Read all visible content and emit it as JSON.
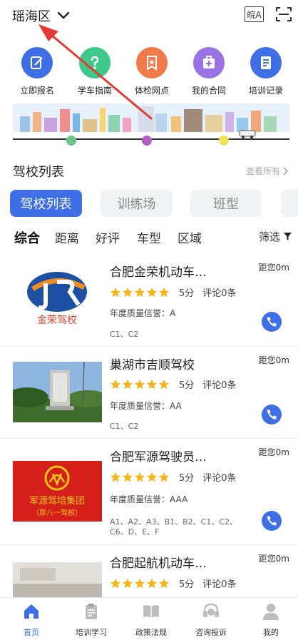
{
  "header": {
    "city": "瑶海区",
    "font_toggle": "皖A"
  },
  "quick_actions": [
    {
      "label": "立即报名",
      "icon": "edit-icon",
      "color": "#3f6fe7"
    },
    {
      "label": "学车指南",
      "icon": "question-icon",
      "color": "#3ec88a"
    },
    {
      "label": "体检网点",
      "icon": "bookmark-star-icon",
      "color": "#f07a4a"
    },
    {
      "label": "我的合同",
      "icon": "medical-kit-icon",
      "color": "#9a72e6"
    },
    {
      "label": "培训记录",
      "icon": "document-icon",
      "color": "#3f6fe7"
    }
  ],
  "section": {
    "title": "驾校列表",
    "view_all": "查看所有"
  },
  "tabs": [
    "驾校列表",
    "训练场",
    "班型",
    "教"
  ],
  "filters": {
    "items": [
      "综合",
      "距离",
      "好评",
      "车型",
      "区域"
    ],
    "filter_label": "筛选"
  },
  "schools": [
    {
      "name": "合肥金荣机动车…",
      "distance": "距您0m",
      "rating": 5,
      "score": "5分",
      "reviews": "评论0条",
      "quality": "年度质量信誉：A",
      "types": "C1、C2",
      "logo_text": "金荣驾校"
    },
    {
      "name": "巢湖市吉顺驾校",
      "distance": "距您0m",
      "rating": 5,
      "score": "5分",
      "reviews": "评论0条",
      "quality": "年度质量信誉：AA",
      "types": "C1、C2"
    },
    {
      "name": "合肥军源驾驶员…",
      "distance": "距您0m",
      "rating": 5,
      "score": "5分",
      "reviews": "评论0条",
      "quality": "年度质量信誉：AAA",
      "types": "A1、A2、A3、B1、B2、C1、C2、C6、D、E、F",
      "logo_text": "军源驾培集团",
      "logo_sub": "（原八一驾校）"
    },
    {
      "name": "合肥起航机动车…",
      "distance": "距您0m",
      "rating": 5,
      "score": "5分",
      "reviews": "评论0条"
    }
  ],
  "bottom_nav": [
    {
      "label": "首页",
      "icon": "home-icon",
      "active": true
    },
    {
      "label": "培训学习",
      "icon": "clipboard-icon",
      "active": false
    },
    {
      "label": "政策法规",
      "icon": "book-icon",
      "active": false
    },
    {
      "label": "咨询投诉",
      "icon": "headset-icon",
      "active": false
    },
    {
      "label": "我的",
      "icon": "person-icon",
      "active": false
    }
  ],
  "colors": {
    "accent": "#3f6fe7",
    "star": "#f6b419",
    "annotation_arrow": "#e53935"
  }
}
